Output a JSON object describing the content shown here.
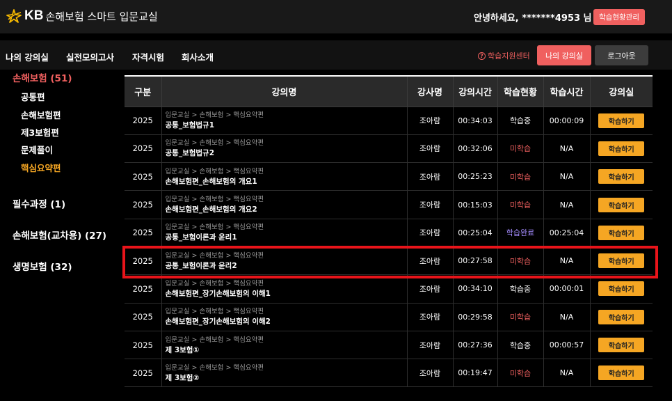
{
  "header": {
    "logo_kb": "KB",
    "logo_text": "손해보험 스마트 입문교실",
    "greeting": "안녕하세요, *******4953 님 |",
    "status_button": "학습현황관리"
  },
  "nav": {
    "items": [
      "나의 강의실",
      "실전모의고사",
      "자격시험",
      "회사소개"
    ],
    "help_icon": "?",
    "help_link": "학습지원센터",
    "my_lecture_button": "나의 강의실",
    "logout_button": "로그아웃"
  },
  "sidebar": {
    "categories": [
      {
        "label": "손해보험 (51)"
      },
      {
        "label": "필수과정 (1)"
      },
      {
        "label": "손해보험(교차용) (27)"
      },
      {
        "label": "생명보험 (32)"
      }
    ],
    "subitems": [
      "공통편",
      "손해보험편",
      "제3보험편",
      "문제풀이",
      "핵심요약편"
    ]
  },
  "table": {
    "headers": [
      "구분",
      "강의명",
      "강사명",
      "강의시간",
      "학습현황",
      "학습시간",
      "강의실"
    ],
    "rows": [
      {
        "year": "2025",
        "crumb": "입문교실 > 손해보험 > 핵심요약편",
        "name": "공통_보험법규1",
        "instructor": "조아람",
        "duration": "00:34:03",
        "status": "학습중",
        "status_type": "progress",
        "study_time": "00:00:09",
        "action": "학습하기"
      },
      {
        "year": "2025",
        "crumb": "입문교실 > 손해보험 > 핵심요약편",
        "name": "공통_보험법규2",
        "instructor": "조아람",
        "duration": "00:32:06",
        "status": "미학습",
        "status_type": "none",
        "study_time": "N/A",
        "action": "학습하기"
      },
      {
        "year": "2025",
        "crumb": "입문교실 > 손해보험 > 핵심요약편",
        "name": "손해보험편_손해보험의 개요1",
        "instructor": "조아람",
        "duration": "00:25:23",
        "status": "미학습",
        "status_type": "none",
        "study_time": "N/A",
        "action": "학습하기"
      },
      {
        "year": "2025",
        "crumb": "입문교실 > 손해보험 > 핵심요약편",
        "name": "손해보험편_손해보험의 개요2",
        "instructor": "조아람",
        "duration": "00:15:03",
        "status": "미학습",
        "status_type": "none",
        "study_time": "N/A",
        "action": "학습하기"
      },
      {
        "year": "2025",
        "crumb": "입문교실 > 손해보험 > 핵심요약편",
        "name": "공통_보험이론과 윤리1",
        "instructor": "조아람",
        "duration": "00:25:04",
        "status": "학습완료",
        "status_type": "done",
        "study_time": "00:25:04",
        "action": "학습하기"
      },
      {
        "year": "2025",
        "crumb": "입문교실 > 손해보험 > 핵심요약편",
        "name": "공통_보험이론과 윤리2",
        "instructor": "조아람",
        "duration": "00:27:58",
        "status": "미학습",
        "status_type": "none",
        "study_time": "N/A",
        "action": "학습하기"
      },
      {
        "year": "2025",
        "crumb": "입문교실 > 손해보험 > 핵심요약편",
        "name": "손해보험편_장기손해보험의 이해1",
        "instructor": "조아람",
        "duration": "00:34:10",
        "status": "학습중",
        "status_type": "progress",
        "study_time": "00:00:01",
        "action": "학습하기"
      },
      {
        "year": "2025",
        "crumb": "입문교실 > 손해보험 > 핵심요약편",
        "name": "손해보험편_장기손해보험의 이해2",
        "instructor": "조아람",
        "duration": "00:29:58",
        "status": "미학습",
        "status_type": "none",
        "study_time": "N/A",
        "action": "학습하기"
      },
      {
        "year": "2025",
        "crumb": "입문교실 > 손해보험 > 핵심요약편",
        "name": "제 3보험①",
        "instructor": "조아람",
        "duration": "00:27:36",
        "status": "학습중",
        "status_type": "progress",
        "study_time": "00:00:57",
        "action": "학습하기"
      },
      {
        "year": "2025",
        "crumb": "입문교실 > 손해보험 > 핵심요약편",
        "name": "제 3보험②",
        "instructor": "조아람",
        "duration": "00:19:47",
        "status": "미학습",
        "status_type": "none",
        "study_time": "N/A",
        "action": "학습하기"
      }
    ]
  },
  "colors": {
    "accent_red": "#f0605f",
    "accent_orange": "#f5a623",
    "status_done": "#a58cff",
    "highlight_box": "#e8141a"
  }
}
